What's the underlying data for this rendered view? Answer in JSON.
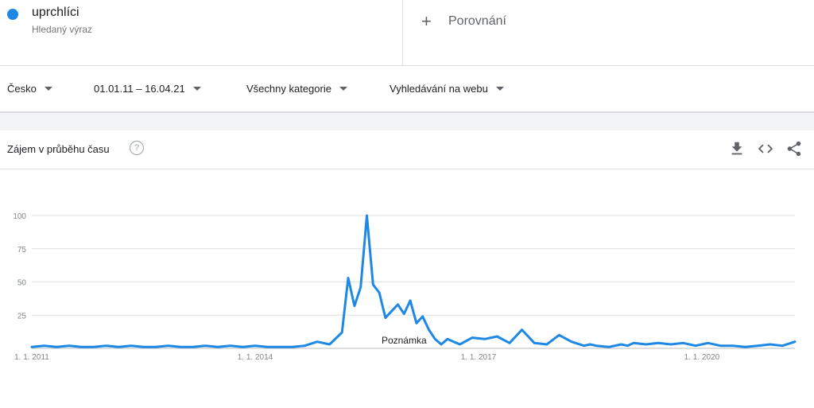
{
  "colors": {
    "series": "#1e88e5",
    "grid": "#e0e0e0",
    "axis_text": "#80868b"
  },
  "search_term": {
    "name": "uprchlíci",
    "subtitle": "Hledaný výraz"
  },
  "compare": {
    "label": "Porovnání",
    "icon": "plus-icon"
  },
  "filters": {
    "region": "Česko",
    "time_range": "01.01.11 – 16.04.21",
    "category": "Všechny kategorie",
    "search_type": "Vyhledávání na webu"
  },
  "card": {
    "title": "Zájem v průběhu času",
    "icons": [
      "help-icon",
      "download-icon",
      "embed-icon",
      "share-icon"
    ]
  },
  "chart_data": {
    "type": "line",
    "title": "",
    "xlabel": "",
    "ylabel": "",
    "ylim": [
      0,
      100
    ],
    "y_ticks": [
      25,
      50,
      75,
      100
    ],
    "x_ticks": [
      "1. 1. 2011",
      "1. 1. 2014",
      "1. 1. 2017",
      "1. 1. 2020"
    ],
    "x_range": [
      "2011-01",
      "2021-04"
    ],
    "annotation": {
      "label": "Poznámka",
      "x": "2016-01"
    },
    "grid": true,
    "series": [
      {
        "x": [
          "2011-01",
          "2011-03",
          "2011-05",
          "2011-07",
          "2011-09",
          "2011-11",
          "2012-01",
          "2012-03",
          "2012-05",
          "2012-07",
          "2012-09",
          "2012-11",
          "2013-01",
          "2013-03",
          "2013-05",
          "2013-07",
          "2013-09",
          "2013-11",
          "2014-01",
          "2014-03",
          "2014-05",
          "2014-07",
          "2014-09",
          "2014-11",
          "2015-01",
          "2015-03",
          "2015-04",
          "2015-05",
          "2015-06",
          "2015-07",
          "2015-08",
          "2015-09",
          "2015-10",
          "2015-11",
          "2015-12",
          "2016-01",
          "2016-02",
          "2016-03",
          "2016-04",
          "2016-05",
          "2016-06",
          "2016-07",
          "2016-08",
          "2016-09",
          "2016-10",
          "2016-12",
          "2017-02",
          "2017-04",
          "2017-06",
          "2017-08",
          "2017-10",
          "2017-12",
          "2018-02",
          "2018-04",
          "2018-06",
          "2018-07",
          "2018-08",
          "2018-10",
          "2018-12",
          "2019-01",
          "2019-02",
          "2019-04",
          "2019-06",
          "2019-08",
          "2019-10",
          "2019-12",
          "2020-02",
          "2020-04",
          "2020-06",
          "2020-08",
          "2020-10",
          "2020-12",
          "2021-02",
          "2021-04"
        ],
        "y": [
          1,
          2,
          1,
          2,
          1,
          1,
          2,
          1,
          2,
          1,
          1,
          2,
          1,
          1,
          2,
          1,
          2,
          1,
          2,
          1,
          1,
          1,
          2,
          5,
          3,
          12,
          53,
          32,
          46,
          100,
          48,
          42,
          23,
          28,
          33,
          26,
          36,
          19,
          24,
          14,
          7,
          3,
          7,
          5,
          3,
          8,
          7,
          9,
          4,
          14,
          4,
          3,
          10,
          5,
          2,
          3,
          2,
          1,
          3,
          2,
          4,
          3,
          4,
          3,
          4,
          2,
          4,
          2,
          2,
          1,
          2,
          3,
          2,
          5
        ]
      }
    ]
  }
}
